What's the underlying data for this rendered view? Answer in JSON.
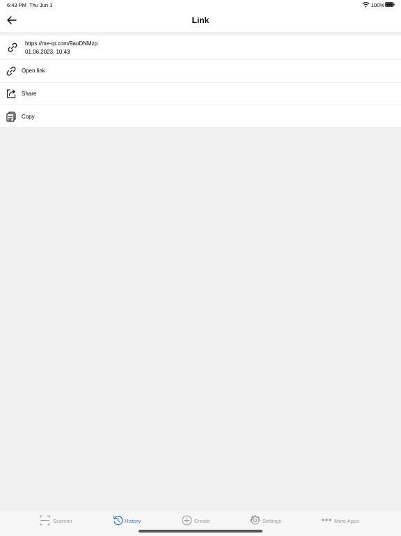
{
  "status_bar": {
    "time": "6:43 PM",
    "date": "Thu Jun 1",
    "battery": "100%"
  },
  "nav": {
    "title": "Link"
  },
  "item": {
    "url": "https://me-qr.com/9aoDNMzp",
    "timestamp": "01.06.2023, 10:43"
  },
  "actions": [
    {
      "label": "Open link",
      "icon": "link-icon"
    },
    {
      "label": "Share",
      "icon": "share-icon"
    },
    {
      "label": "Copy",
      "icon": "copy-icon"
    }
  ],
  "tabs": [
    {
      "label": "Scanner",
      "icon": "scanner-icon",
      "active": false
    },
    {
      "label": "History",
      "icon": "history-icon",
      "active": true
    },
    {
      "label": "Create",
      "icon": "plus-circle-icon",
      "active": false
    },
    {
      "label": "Settings",
      "icon": "gear-icon",
      "active": false
    },
    {
      "label": "More Apps",
      "icon": "ellipsis-icon",
      "active": false
    }
  ],
  "colors": {
    "accent": "#2b7cd3",
    "inactive": "#9a9a9a",
    "background": "#f1f1f1"
  }
}
